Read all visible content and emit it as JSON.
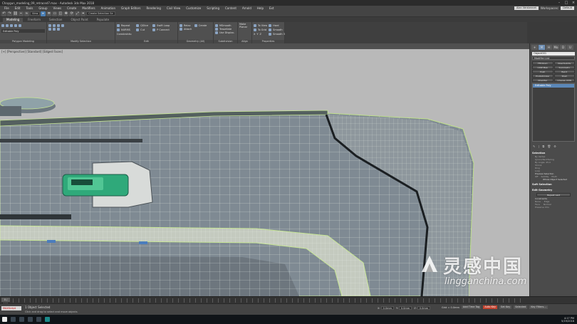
{
  "window": {
    "title": "Chaygun_modeling_09_retraced7.max - Autodesk 3ds Max 2018",
    "minimize_glyph": "–",
    "maximize_glyph": "□",
    "close_glyph": "×"
  },
  "menu": {
    "items": [
      "File",
      "Edit",
      "Tools",
      "Group",
      "Views",
      "Create",
      "Modifiers",
      "Animation",
      "Graph Editors",
      "Rendering",
      "Civil View",
      "Customize",
      "Scripting",
      "Content",
      "Arnold",
      "Help",
      "Ext"
    ],
    "user_name": "Alan Verstennet",
    "workspaces_label": "Workspaces:",
    "workspace_value": "Default"
  },
  "main_toolbar": {
    "selection_filter": "View",
    "named_selection": "Create Selection Se",
    "icons": [
      "undo-icon",
      "redo-icon",
      "link-icon",
      "unlink-icon",
      "bind-icon",
      "select-icon",
      "select-name-icon",
      "rect-select-icon",
      "window-icon",
      "move-icon",
      "rotate-icon",
      "scale-icon",
      "snap-icon"
    ]
  },
  "ribbon": {
    "tabs": [
      "Modeling",
      "Freeform",
      "Selection",
      "Object Paint",
      "Populate"
    ],
    "active_tab": "Modeling",
    "panels": {
      "polygon_modeling": {
        "label": "Polygon Modeling",
        "dropdown": "Editable Poly"
      },
      "modify_selection": {
        "label": "Modify Selection"
      },
      "edit": {
        "label": "Edit",
        "items": [
          "Repeat",
          "QSlice",
          "Swift Loop",
          "NURMS",
          "Cut",
          "P Connect",
          "Constraints:"
        ]
      },
      "geometry": {
        "label": "Geometry (All)",
        "items": [
          "Relax",
          "Create",
          "Attach"
        ]
      },
      "subdivision": {
        "label": "Subdivision",
        "items": [
          "MSmooth",
          "Tessellate",
          "Use Displac."
        ]
      },
      "align": {
        "label": "Align",
        "items": [
          "Make Planar"
        ]
      },
      "properties": {
        "label": "Properties",
        "items": [
          "To View",
          "To Grid",
          "X",
          "Y",
          "Z",
          "Hard",
          "Smooth",
          "Smooth 30"
        ]
      }
    }
  },
  "viewport": {
    "label": "[+] [Perspective] [Standard] [Edged Faces]"
  },
  "command_panel": {
    "tabs": [
      "+",
      "M",
      "H",
      "Mo",
      "D",
      "U"
    ],
    "active_tab": "M",
    "object_name": "Object001",
    "modifier_list": "Modifier List",
    "modifier_buttons": [
      "FFD(box)",
      "OpenSubdiv",
      "UVW Map",
      "Symmetry",
      "Push",
      "Bend",
      "ProOptimizer",
      "Shell",
      "Chamfer",
      "Unwrap UVW"
    ],
    "stack_item": "Editable Poly",
    "stack_tools": [
      "pin-stack",
      "show-end",
      "make-unique",
      "remove-modifier",
      "configure"
    ],
    "stack_tool_glyphs": [
      "✎",
      "∣",
      "⧉",
      "🗑",
      "⚙"
    ],
    "selection_rollout": {
      "title": "Selection",
      "options": [
        "By Vertex",
        "Ignore Backfacing",
        "By Angle: 45.0",
        "Shrink",
        "Ring",
        "Loop"
      ],
      "preview_title": "Preview Selection",
      "preview_options": [
        "Off",
        "SubObj",
        "Multi"
      ],
      "status": "Whole Object Selected"
    },
    "soft_selection_title": "Soft Selection",
    "edit_geometry": {
      "title": "Edit Geometry",
      "repeat_last": "Repeat Last",
      "constraints_label": "Constraints",
      "constraint_options": [
        "None",
        "Edge",
        "Face",
        "Normal"
      ],
      "preserve_uvs": "Preserve UVs"
    }
  },
  "timeline": {
    "frame_readout": "0 / 100"
  },
  "status": {
    "maxscript_label": "MAXScript",
    "objects_selected": "1 Object Selected",
    "prompt": "Click and drag to select and move objects",
    "x_label": "X:",
    "x_value": "0.0mm",
    "y_label": "Y:",
    "y_value": "0.0mm",
    "z_label": "Z:",
    "z_value": "0.0mm",
    "grid_label": "Grid = 0.0mm",
    "add_time_tag": "Add Time Tag",
    "auto_key": "Auto Key",
    "set_key": "Set Key",
    "selected_label": "Selected",
    "key_filters": "Key Filters..."
  },
  "taskbar": {
    "time": "4:17 PM",
    "date": "5/19/2018"
  },
  "watermark": {
    "chinese": "灵感中国",
    "url": "lingganchina.com"
  },
  "colors": {
    "viewport_bg": "#b9b9b9",
    "mesh_surface": "#7f8a93",
    "wire": "#e8f0e6",
    "selection_green": "#b8e07a",
    "accent_blue": "#5b87b8",
    "auto_key_red": "#c4432f"
  }
}
